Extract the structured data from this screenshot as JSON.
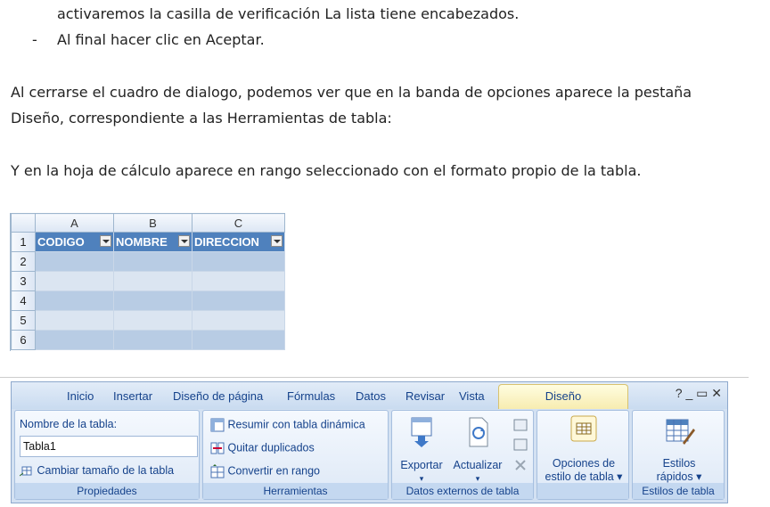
{
  "text": {
    "line1": "activaremos la casilla de verificación La lista tiene encabezados.",
    "bullet_dash": "-",
    "line2": "Al final hacer clic en Aceptar.",
    "para1a": "Al cerrarse el cuadro de dialogo, podemos ver que en la banda de opciones aparece la pestaña",
    "para1b": "Diseño, correspondiente a las Herramientas de tabla:",
    "para2": "Y en la hoja de cálculo aparece en rango seleccionado con el formato propio de la tabla."
  },
  "sheet": {
    "columns": [
      "A",
      "B",
      "C"
    ],
    "rows": [
      "1",
      "2",
      "3",
      "4",
      "5",
      "6"
    ],
    "headers": [
      "CODIGO",
      "NOMBRE",
      "DIRECCION"
    ]
  },
  "ribbon": {
    "tabs": [
      "Inicio",
      "Insertar",
      "Diseño de página",
      "Fórmulas",
      "Datos",
      "Revisar",
      "Vista"
    ],
    "active_tab": "Diseño",
    "window_icons": "? _ ▭ ✕",
    "groups": {
      "propiedades": {
        "label": "Propiedades",
        "name_label": "Nombre de la tabla:",
        "name_value": "Tabla1",
        "resize": "Cambiar tamaño de la tabla"
      },
      "herramientas": {
        "label": "Herramientas",
        "items": [
          "Resumir con tabla dinámica",
          "Quitar duplicados",
          "Convertir en rango"
        ]
      },
      "datos_externos": {
        "label": "Datos externos de tabla",
        "exportar": "Exportar",
        "actualizar": "Actualizar"
      },
      "opciones": {
        "line1": "Opciones de",
        "line2": "estilo de tabla ▾"
      },
      "estilos": {
        "label": "Estilos de tabla",
        "line1": "Estilos",
        "line2": "rápidos ▾"
      }
    }
  }
}
